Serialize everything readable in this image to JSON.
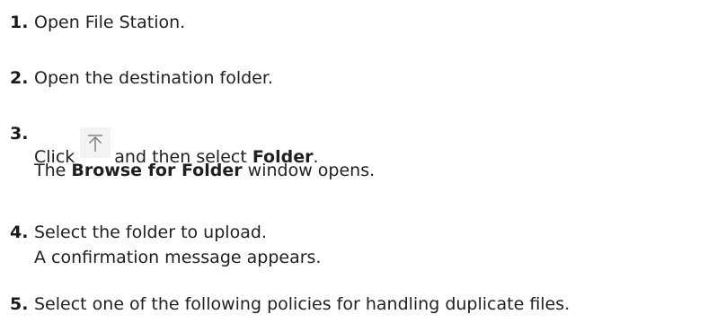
{
  "steps": [
    {
      "number": "1.",
      "text": "Open File Station."
    },
    {
      "number": "2.",
      "text": "Open the destination folder."
    },
    {
      "number": "3.",
      "line1_prefix": "Click",
      "upload_icon": "upload-icon",
      "line1_middle": "and then select",
      "line1_bold": "Folder",
      "line1_suffix": ".",
      "line2_prefix": "The",
      "line2_bold": "Browse for Folder",
      "line2_suffix": "window opens."
    },
    {
      "number": "4.",
      "line1": "Select the folder to upload.",
      "line2": "A confirmation message appears."
    },
    {
      "number": "5.",
      "text": "Select one of the following policies for handling duplicate files."
    }
  ]
}
